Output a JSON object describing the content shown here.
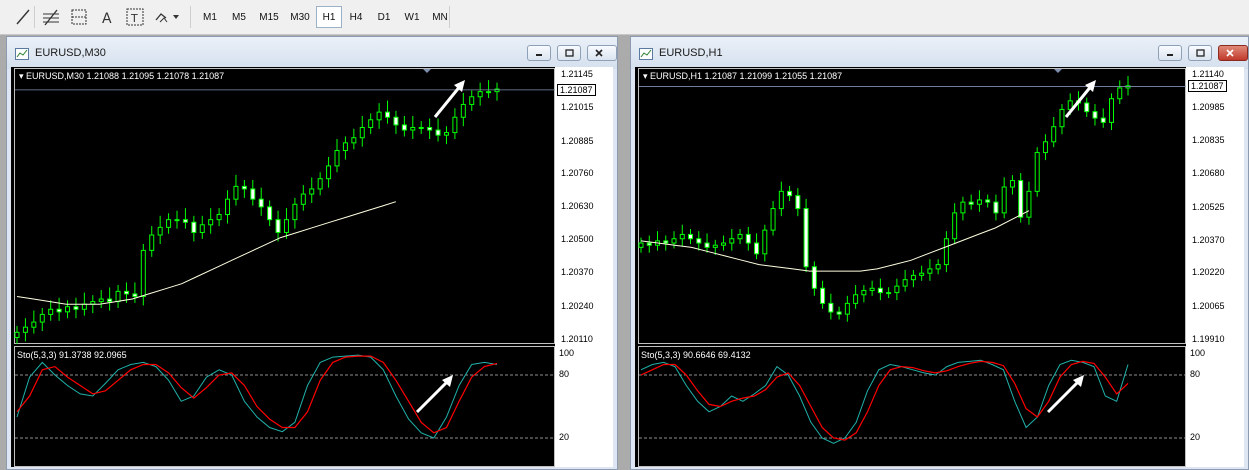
{
  "toolbar": {
    "timeframes": [
      "M1",
      "M5",
      "M15",
      "M30",
      "H1",
      "H4",
      "D1",
      "W1",
      "MN"
    ],
    "active_timeframe": "H1",
    "icons": [
      "line-tool-icon",
      "fibonacci-icon",
      "grid-tool-icon",
      "text-tool-icon",
      "text-label-icon",
      "shapes-dropdown-icon"
    ]
  },
  "colors": {
    "bull": "#00ff00",
    "bear": "#ffffff",
    "ma": "#ffffe0",
    "stoch_main": "#20b2aa",
    "stoch_signal": "#ff0000"
  },
  "windows": [
    {
      "title": "EURUSD,M30",
      "ohlc_line": "EURUSD,M30  1.21088 1.21095 1.21078 1.21087",
      "current_price": "1.21087",
      "price_ticks": [
        "1.21145",
        "1.21015",
        "1.20885",
        "1.20760",
        "1.20630",
        "1.20500",
        "1.20370",
        "1.20240",
        "1.20110"
      ],
      "stoch_label": "Sto(5,3,3) 91.3738 92.0965",
      "stoch_ticks": [
        "100",
        "80",
        "20"
      ]
    },
    {
      "title": "EURUSD,H1",
      "ohlc_line": "EURUSD,H1  1.21087 1.21099 1.21055 1.21087",
      "current_price": "1.21087",
      "price_ticks": [
        "1.21140",
        "1.20985",
        "1.20835",
        "1.20680",
        "1.20525",
        "1.20370",
        "1.20220",
        "1.20065",
        "1.19910"
      ],
      "stoch_label": "Sto(5,3,3) 90.6646 69.4132",
      "stoch_ticks": [
        "100",
        "80",
        "20"
      ]
    }
  ],
  "chart_data": [
    {
      "type": "candlestick",
      "symbol": "EURUSD",
      "timeframe": "M30",
      "ylim": [
        1.2011,
        1.21145
      ],
      "closes": [
        1.2014,
        1.2016,
        1.2018,
        1.2021,
        1.2023,
        1.2022,
        1.2024,
        1.2023,
        1.2025,
        1.2026,
        1.2027,
        1.2026,
        1.203,
        1.2029,
        1.2028,
        1.2046,
        1.2052,
        1.2055,
        1.2058,
        1.2058,
        1.2057,
        1.2053,
        1.2056,
        1.2058,
        1.206,
        1.2066,
        1.2071,
        1.207,
        1.2066,
        1.2063,
        1.2058,
        1.2053,
        1.2058,
        1.2064,
        1.2068,
        1.207,
        1.2074,
        1.2079,
        1.2085,
        1.2088,
        1.209,
        1.2094,
        1.2097,
        1.21,
        1.2098,
        1.2095,
        1.2093,
        1.2094,
        1.2094,
        1.2093,
        1.2091,
        1.2092,
        1.2098,
        1.2103,
        1.2106,
        1.2108,
        1.2108,
        1.2109
      ],
      "ma": [
        1.2028,
        1.2027,
        1.2026,
        1.2025,
        1.2025,
        1.2025,
        1.2026,
        1.2027,
        1.2029,
        1.2031,
        1.2033,
        1.2036,
        1.2039,
        1.2042,
        1.2045,
        1.2048,
        1.2051,
        1.2053,
        1.2055,
        1.2057,
        1.2059,
        1.2061,
        1.2063,
        1.2065
      ],
      "stoch_main": [
        40,
        78,
        92,
        80,
        70,
        62,
        60,
        72,
        85,
        90,
        92,
        88,
        75,
        55,
        60,
        78,
        85,
        80,
        55,
        40,
        30,
        26,
        35,
        70,
        92,
        97,
        98,
        99,
        97,
        85,
        60,
        38,
        25,
        20,
        40,
        70,
        90,
        92,
        90
      ],
      "stoch_signal": [
        45,
        60,
        85,
        88,
        78,
        70,
        62,
        65,
        75,
        85,
        90,
        90,
        82,
        68,
        58,
        68,
        80,
        82,
        70,
        50,
        38,
        30,
        30,
        45,
        75,
        92,
        97,
        98,
        98,
        92,
        75,
        55,
        35,
        25,
        30,
        55,
        78,
        88,
        91
      ]
    },
    {
      "type": "candlestick",
      "symbol": "EURUSD",
      "timeframe": "H1",
      "ylim": [
        1.1991,
        1.2114
      ],
      "closes": [
        1.2036,
        1.2035,
        1.2037,
        1.2036,
        1.2038,
        1.204,
        1.2038,
        1.2036,
        1.2034,
        1.2035,
        1.2036,
        1.2038,
        1.204,
        1.2036,
        1.2031,
        1.2042,
        1.2052,
        1.206,
        1.2058,
        1.2052,
        1.2025,
        1.2015,
        1.2008,
        1.2004,
        1.2003,
        1.2008,
        1.2012,
        1.2014,
        1.2015,
        1.2013,
        1.2013,
        1.2016,
        1.2019,
        1.2021,
        1.2022,
        1.2024,
        1.2026,
        1.2038,
        1.205,
        1.2055,
        1.2054,
        1.2056,
        1.2055,
        1.205,
        1.2062,
        1.2065,
        1.2048,
        1.206,
        1.2078,
        1.2083,
        1.209,
        1.2098,
        1.2102,
        1.2101,
        1.2097,
        1.2094,
        1.2092,
        1.2103,
        1.2108,
        1.2109
      ],
      "ma": [
        1.2037,
        1.2036,
        1.2035,
        1.2034,
        1.2032,
        1.203,
        1.2028,
        1.2026,
        1.2025,
        1.2024,
        1.2023,
        1.2023,
        1.2023,
        1.2023,
        1.2024,
        1.2026,
        1.2028,
        1.2031,
        1.2034,
        1.2037,
        1.204,
        1.2043,
        1.2047,
        1.2051
      ],
      "stoch_main": [
        85,
        90,
        92,
        88,
        70,
        55,
        45,
        50,
        60,
        55,
        62,
        70,
        88,
        80,
        60,
        35,
        20,
        15,
        20,
        35,
        65,
        85,
        90,
        88,
        85,
        82,
        80,
        88,
        92,
        93,
        94,
        90,
        85,
        55,
        30,
        40,
        70,
        90,
        94,
        92,
        88,
        60,
        55,
        90
      ],
      "stoch_signal": [
        80,
        85,
        90,
        90,
        80,
        65,
        52,
        50,
        55,
        58,
        60,
        66,
        78,
        82,
        70,
        50,
        30,
        20,
        18,
        25,
        45,
        70,
        85,
        88,
        87,
        84,
        82,
        84,
        88,
        91,
        93,
        92,
        89,
        72,
        48,
        40,
        55,
        78,
        90,
        93,
        91,
        78,
        62,
        72
      ]
    }
  ]
}
